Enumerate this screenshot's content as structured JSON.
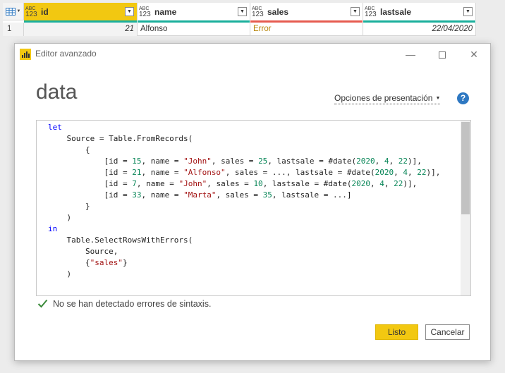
{
  "grid": {
    "type_badge": {
      "top": "ABC",
      "bottom": "123"
    },
    "columns": [
      {
        "name": "id",
        "quality_color": "#1aaf9c"
      },
      {
        "name": "name",
        "quality_color": "#1aaf9c"
      },
      {
        "name": "sales",
        "quality_color": "#e65b50"
      },
      {
        "name": "lastsale",
        "quality_color": "#1aaf9c"
      }
    ],
    "row": {
      "number": "1",
      "id": "21",
      "name": "Alfonso",
      "sales": "Error",
      "lastsale": "22/04/2020"
    }
  },
  "dialog": {
    "title": "Editor avanzado",
    "query_name": "data",
    "display_options_label": "Opciones de presentación",
    "help_symbol": "?",
    "syntax_status": "No se han detectado errores de sintaxis.",
    "ok_label": "Listo",
    "cancel_label": "Cancelar",
    "accent_color": "#f2c811"
  },
  "code_lines": [
    [
      {
        "t": "let",
        "c": "kw"
      }
    ],
    [
      {
        "t": "    Source = Table.FromRecords(",
        "c": "tx"
      }
    ],
    [
      {
        "t": "        {",
        "c": "tx"
      }
    ],
    [
      {
        "t": "            [id = ",
        "c": "tx"
      },
      {
        "t": "15",
        "c": "num"
      },
      {
        "t": ", name = ",
        "c": "tx"
      },
      {
        "t": "\"John\"",
        "c": "str"
      },
      {
        "t": ", sales = ",
        "c": "tx"
      },
      {
        "t": "25",
        "c": "num"
      },
      {
        "t": ", lastsale = #date(",
        "c": "tx"
      },
      {
        "t": "2020",
        "c": "num"
      },
      {
        "t": ", ",
        "c": "tx"
      },
      {
        "t": "4",
        "c": "num"
      },
      {
        "t": ", ",
        "c": "tx"
      },
      {
        "t": "22",
        "c": "num"
      },
      {
        "t": ")],",
        "c": "tx"
      }
    ],
    [
      {
        "t": "            [id = ",
        "c": "tx"
      },
      {
        "t": "21",
        "c": "num"
      },
      {
        "t": ", name = ",
        "c": "tx"
      },
      {
        "t": "\"Alfonso\"",
        "c": "str"
      },
      {
        "t": ", sales = ..., lastsale = #date(",
        "c": "tx"
      },
      {
        "t": "2020",
        "c": "num"
      },
      {
        "t": ", ",
        "c": "tx"
      },
      {
        "t": "4",
        "c": "num"
      },
      {
        "t": ", ",
        "c": "tx"
      },
      {
        "t": "22",
        "c": "num"
      },
      {
        "t": ")],",
        "c": "tx"
      }
    ],
    [
      {
        "t": "            [id = ",
        "c": "tx"
      },
      {
        "t": "7",
        "c": "num"
      },
      {
        "t": ", name = ",
        "c": "tx"
      },
      {
        "t": "\"John\"",
        "c": "str"
      },
      {
        "t": ", sales = ",
        "c": "tx"
      },
      {
        "t": "10",
        "c": "num"
      },
      {
        "t": ", lastsale = #date(",
        "c": "tx"
      },
      {
        "t": "2020",
        "c": "num"
      },
      {
        "t": ", ",
        "c": "tx"
      },
      {
        "t": "4",
        "c": "num"
      },
      {
        "t": ", ",
        "c": "tx"
      },
      {
        "t": "22",
        "c": "num"
      },
      {
        "t": ")],",
        "c": "tx"
      }
    ],
    [
      {
        "t": "            [id = ",
        "c": "tx"
      },
      {
        "t": "33",
        "c": "num"
      },
      {
        "t": ", name = ",
        "c": "tx"
      },
      {
        "t": "\"Marta\"",
        "c": "str"
      },
      {
        "t": ", sales = ",
        "c": "tx"
      },
      {
        "t": "35",
        "c": "num"
      },
      {
        "t": ", lastsale = ...]",
        "c": "tx"
      }
    ],
    [
      {
        "t": "        }",
        "c": "tx"
      }
    ],
    [
      {
        "t": "    )",
        "c": "tx"
      }
    ],
    [
      {
        "t": "in",
        "c": "kw"
      }
    ],
    [
      {
        "t": "    Table.SelectRowsWithErrors(",
        "c": "tx"
      }
    ],
    [
      {
        "t": "        Source,",
        "c": "tx"
      }
    ],
    [
      {
        "t": "        {",
        "c": "tx"
      },
      {
        "t": "\"sales\"",
        "c": "str"
      },
      {
        "t": "}",
        "c": "tx"
      }
    ],
    [
      {
        "t": "    )",
        "c": "tx"
      }
    ]
  ],
  "code_colors": {
    "kw": "#0000ff",
    "str": "#a31515",
    "num": "#098658",
    "tx": "#222222"
  }
}
